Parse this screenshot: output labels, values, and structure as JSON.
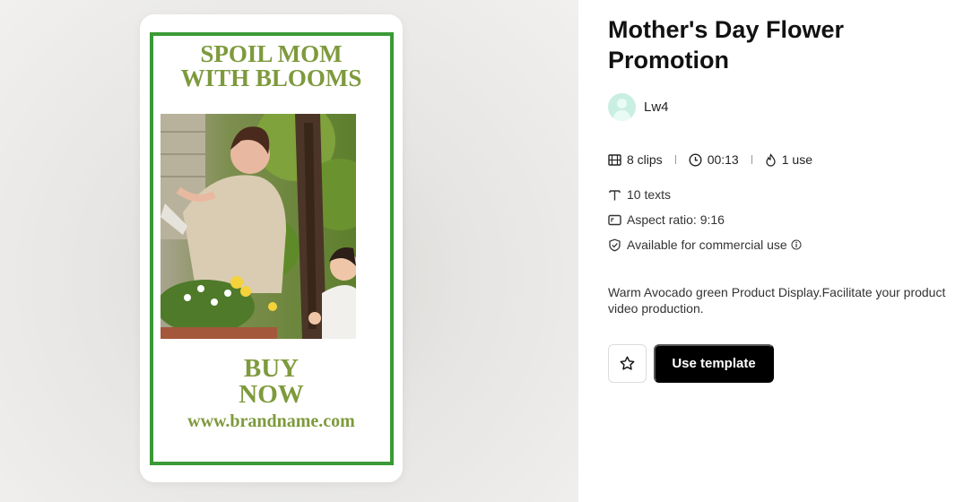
{
  "preview": {
    "headline_line1": "SPOIL MOM",
    "headline_line2": "WITH BLOOMS",
    "cta_line1": "BUY",
    "cta_line2": "NOW",
    "url": "www.brandname.com",
    "accent_color": "#7e9a3d",
    "frame_color": "#3a9a35"
  },
  "template": {
    "title": "Mother's Day Flower Promotion",
    "author": "Lw4",
    "clips": "8 clips",
    "duration": "00:13",
    "uses": "1 use",
    "texts": "10 texts",
    "aspect_ratio": "Aspect ratio: 9:16",
    "commercial": "Available for commercial use",
    "description": "Warm Avocado green Product Display.Facilitate your product video production."
  },
  "actions": {
    "use_template_label": "Use template"
  },
  "icons": {
    "clips": "film-icon",
    "duration": "clock-icon",
    "uses": "flame-icon",
    "texts": "text-icon",
    "aspect": "aspect-ratio-icon",
    "commercial": "shield-check-icon",
    "info": "info-icon",
    "favorite": "star-icon"
  }
}
